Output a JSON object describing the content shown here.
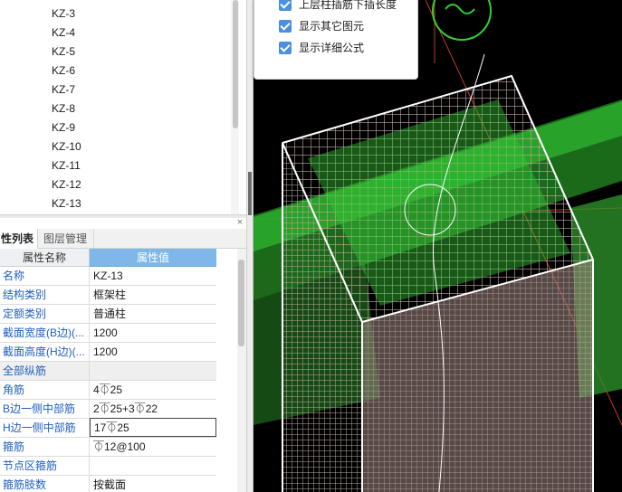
{
  "component_list": {
    "items": [
      "KZ-3",
      "KZ-4",
      "KZ-5",
      "KZ-6",
      "KZ-7",
      "KZ-8",
      "KZ-9",
      "KZ-10",
      "KZ-11",
      "KZ-12",
      "KZ-13"
    ]
  },
  "panel": {
    "close_glyph": "×",
    "tabs": [
      "性列表",
      "图层管理"
    ]
  },
  "properties": {
    "header_name": "属性名称",
    "header_value": "属性值",
    "rows": [
      {
        "name": "名称",
        "value": "KZ-13"
      },
      {
        "name": "结构类别",
        "value": "框架柱"
      },
      {
        "name": "定额类别",
        "value": "普通柱"
      },
      {
        "name": "截面宽度(B边)(...",
        "value": "1200"
      },
      {
        "name": "截面高度(H边)(...",
        "value": "1200"
      },
      {
        "name": "全部纵筋",
        "value": ""
      },
      {
        "name": "角筋",
        "value": "4⏁25"
      },
      {
        "name": "B边一侧中部筋",
        "value": "2⏁25+3⏁22"
      },
      {
        "name": "H边一侧中部筋",
        "value": "17⏁25"
      },
      {
        "name": "箍筋",
        "value": "⏁12@100"
      },
      {
        "name": "节点区箍筋",
        "value": ""
      },
      {
        "name": "箍筋肢数",
        "value": "按截面"
      }
    ]
  },
  "view_options": {
    "items": [
      "上层柱插筋下插长度",
      "显示其它图元",
      "显示详细公式"
    ],
    "checked": [
      true,
      true,
      true
    ]
  },
  "colors": {
    "viewport_bg": "#000000",
    "slab_green": "#2fb52f",
    "rebar_color": "#c2a9a2",
    "accent_blue": "#7fb8e8",
    "checkbox_blue": "#4a8fe0",
    "axis_red": "#c43a1a"
  }
}
